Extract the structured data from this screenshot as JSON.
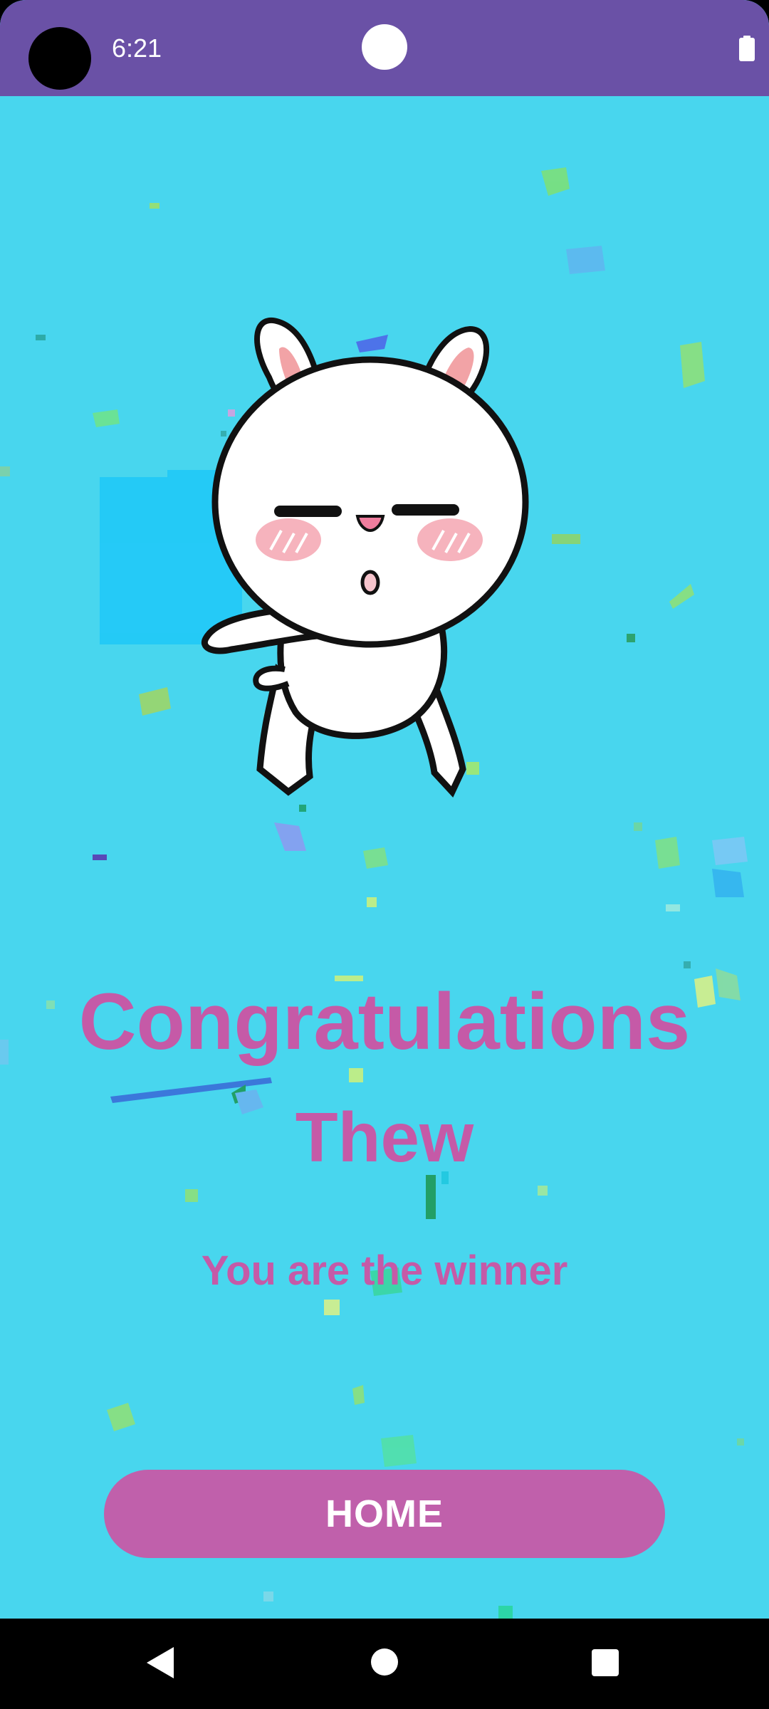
{
  "status_bar": {
    "time": "6:21",
    "icons": [
      "camera-cutout",
      "notification-dot-icon",
      "battery-icon"
    ]
  },
  "main": {
    "title": "Congratulations",
    "winner_name": "Thew",
    "subtitle": "You are the winner",
    "home_button_label": "HOME",
    "image": "dancing-bunny-sticker"
  },
  "nav_bar": {
    "icons": [
      "back-icon",
      "home-icon",
      "recents-icon"
    ]
  },
  "colors": {
    "status_bar": "#6a51a6",
    "background": "#48d6ee",
    "accent_text": "#c55aa7",
    "button": "#c060ab",
    "button_text": "#ffffff",
    "nav_bar": "#000000"
  }
}
